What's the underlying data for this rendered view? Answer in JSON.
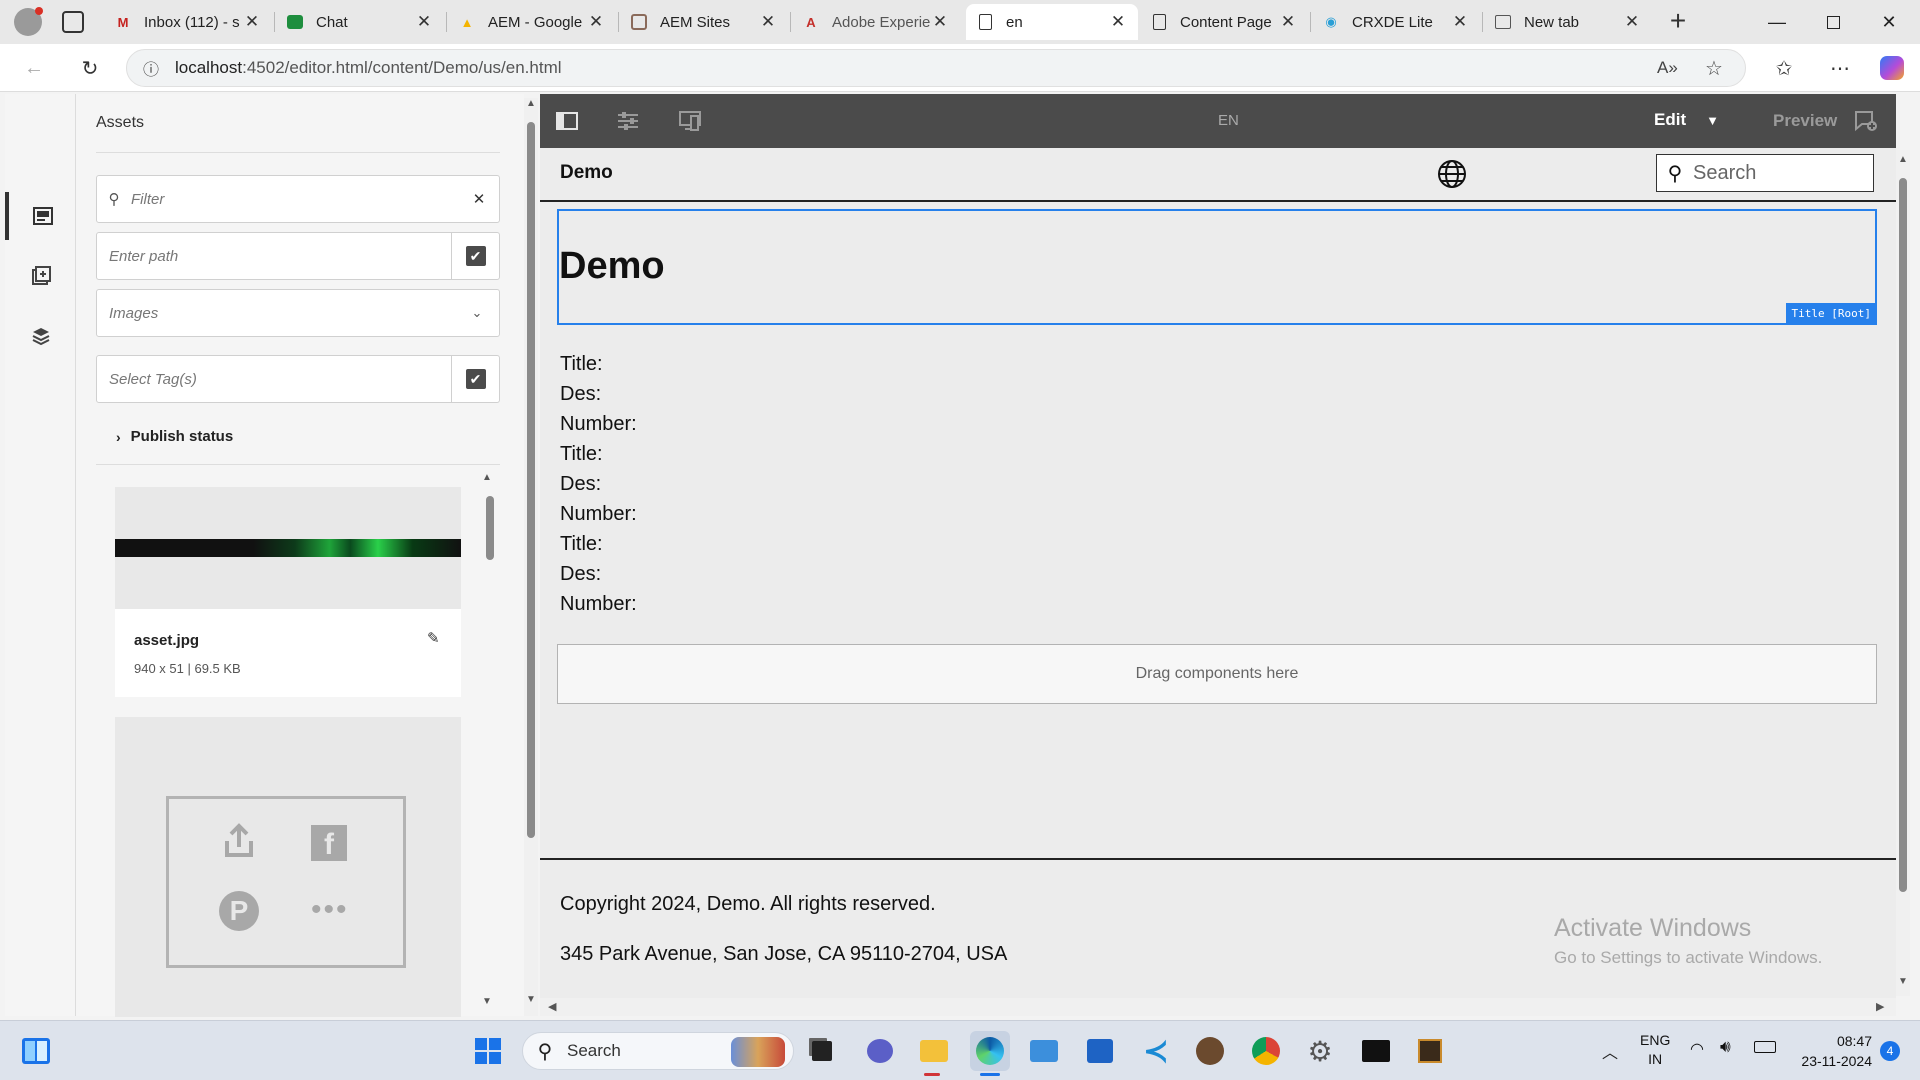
{
  "browser": {
    "tabs": [
      {
        "label": "Inbox (112) - s",
        "icon": "gmail-icon",
        "active": false
      },
      {
        "label": "Chat",
        "icon": "chat-icon",
        "active": false
      },
      {
        "label": "AEM - Google",
        "icon": "google-drive-icon",
        "active": false
      },
      {
        "label": "AEM Sites",
        "icon": "aem-sites-icon",
        "active": false
      },
      {
        "label": "Adobe Experie",
        "icon": "adobe-icon",
        "active": false
      },
      {
        "label": "en",
        "icon": "page-icon",
        "active": true
      },
      {
        "label": "Content Page",
        "icon": "page-icon",
        "active": false
      },
      {
        "label": "CRXDE Lite",
        "icon": "crxde-icon",
        "active": false
      },
      {
        "label": "New tab",
        "icon": "newtab-icon",
        "active": false
      }
    ],
    "url_host": "localhost",
    "url_path": ":4502/editor.html/content/Demo/us/en.html"
  },
  "assets_panel": {
    "title": "Assets",
    "filter_placeholder": "Filter",
    "path_placeholder": "Enter path",
    "type_select": "Images",
    "tags_placeholder": "Select Tag(s)",
    "publish_status": "Publish status",
    "assets": [
      {
        "name": "asset.jpg",
        "meta": "940 x 51 | 69.5 KB"
      }
    ]
  },
  "editor": {
    "language": "EN",
    "mode": "Edit",
    "preview": "Preview"
  },
  "page": {
    "site_name": "Demo",
    "search_placeholder": "Search",
    "title": "Demo",
    "title_badge": "Title [Root]",
    "lines": [
      "Title:",
      "Des:",
      "Number:",
      "Title:",
      "Des:",
      "Number:",
      "Title:",
      "Des:",
      "Number:"
    ],
    "drag_hint": "Drag components here",
    "copyright": "Copyright 2024, Demo. All rights reserved.",
    "address": "345 Park Avenue, San Jose, CA 95110-2704, USA",
    "watermark_title": "Activate Windows",
    "watermark_sub": "Go to Settings to activate Windows."
  },
  "taskbar": {
    "search_placeholder": "Search",
    "lang_top": "ENG",
    "lang_bottom": "IN",
    "time": "08:47",
    "date": "23-11-2024",
    "notifications": "4"
  }
}
